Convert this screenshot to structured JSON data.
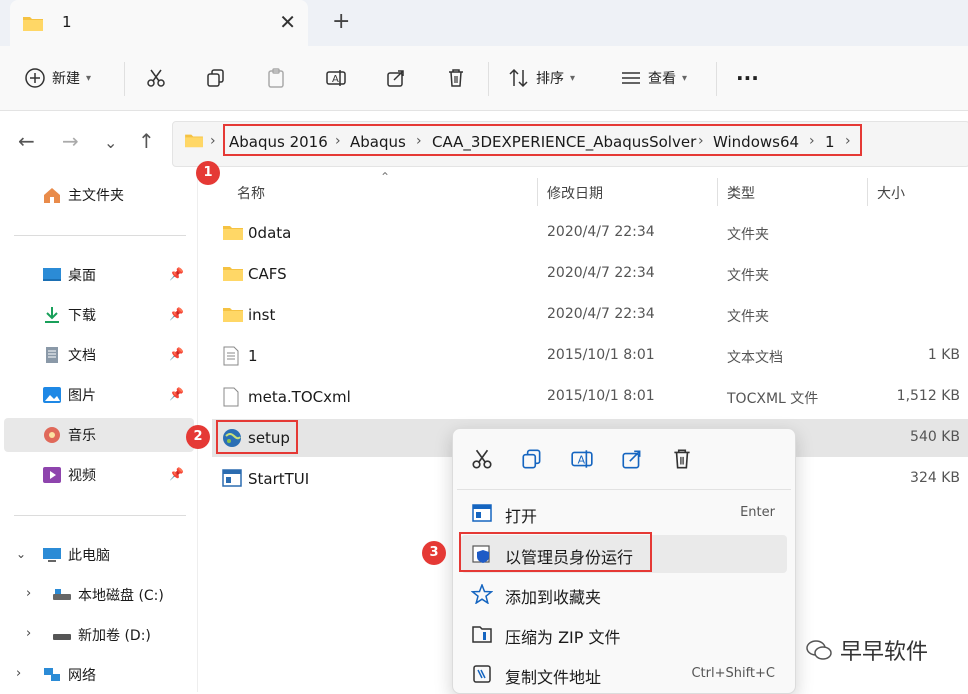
{
  "tab": {
    "title": "1",
    "close_glyph": "✕",
    "new_glyph": "+"
  },
  "toolbar": {
    "new_label": "新建",
    "sort_label": "排序",
    "view_label": "查看",
    "more_glyph": "···"
  },
  "breadcrumbs": [
    "Abaqus 2016",
    "Abaqus",
    "CAA_3DEXPERIENCE_AbaqusSolver",
    "Windows64",
    "1"
  ],
  "sidebar": {
    "home": "主文件夹",
    "quick": [
      {
        "label": "桌面"
      },
      {
        "label": "下载"
      },
      {
        "label": "文档"
      },
      {
        "label": "图片"
      },
      {
        "label": "音乐"
      },
      {
        "label": "视频"
      }
    ],
    "this_pc": "此电脑",
    "drives": [
      {
        "label": "本地磁盘 (C:)"
      },
      {
        "label": "新加卷 (D:)"
      }
    ],
    "network": "网络"
  },
  "columns": {
    "name": "名称",
    "date": "修改日期",
    "type": "类型",
    "size": "大小"
  },
  "files": [
    {
      "name": "0data",
      "date": "2020/4/7 22:34",
      "type": "文件夹",
      "size": ""
    },
    {
      "name": "CAFS",
      "date": "2020/4/7 22:34",
      "type": "文件夹",
      "size": ""
    },
    {
      "name": "inst",
      "date": "2020/4/7 22:34",
      "type": "文件夹",
      "size": ""
    },
    {
      "name": "1",
      "date": "2015/10/1 8:01",
      "type": "文本文档",
      "size": "1 KB"
    },
    {
      "name": "meta.TOCxml",
      "date": "2015/10/1 8:01",
      "type": "TOCXML 文件",
      "size": "1,512 KB"
    },
    {
      "name": "setup",
      "date": "",
      "type": "",
      "size": "540 KB"
    },
    {
      "name": "StartTUI",
      "date": "",
      "type": "",
      "size": "324 KB"
    }
  ],
  "context_menu": {
    "items": [
      {
        "label": "打开",
        "shortcut": "Enter"
      },
      {
        "label": "以管理员身份运行",
        "shortcut": ""
      },
      {
        "label": "添加到收藏夹",
        "shortcut": ""
      },
      {
        "label": "压缩为 ZIP 文件",
        "shortcut": ""
      },
      {
        "label": "复制文件地址",
        "shortcut": "Ctrl+Shift+C"
      }
    ]
  },
  "badges": [
    "1",
    "2",
    "3"
  ],
  "watermark": "早早软件",
  "colors": {
    "accent_red": "#e53935",
    "folder_yellow": "#f5c242",
    "selected_row": "#e5e5e5"
  }
}
